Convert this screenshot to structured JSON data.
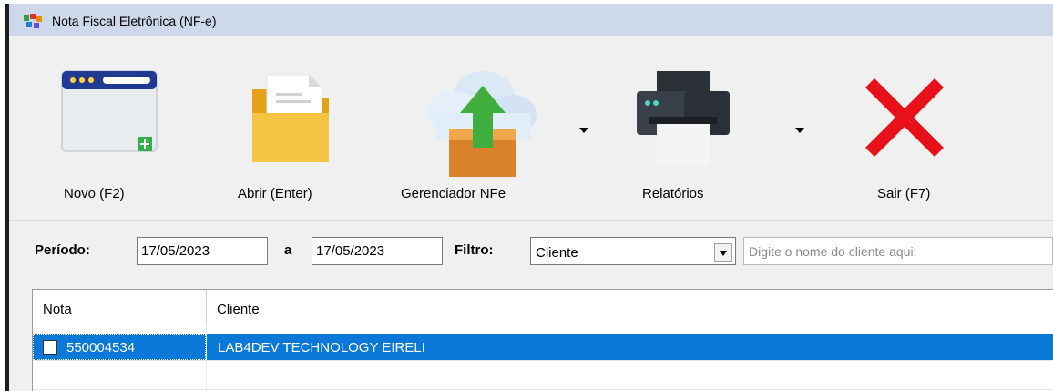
{
  "window": {
    "title": "Nota Fiscal Eletrônica (NF-e)"
  },
  "toolbar": {
    "buttons": [
      {
        "label": "Novo (F2)",
        "icon": "new-window-icon"
      },
      {
        "label": "Abrir (Enter)",
        "icon": "folder-open-icon"
      },
      {
        "label": "Gerenciador NFe",
        "icon": "cloud-upload-icon",
        "has_dropdown": true
      },
      {
        "label": "Relatórios",
        "icon": "printer-icon",
        "has_dropdown": true
      },
      {
        "label": "Sair (F7)",
        "icon": "close-x-icon"
      }
    ]
  },
  "filter": {
    "period_label": "Período:",
    "date_from": "17/05/2023",
    "to_label": "a",
    "date_to": "17/05/2023",
    "filter_label": "Filtro:",
    "filter_value": "Cliente",
    "search_placeholder": "Digite o nome do cliente aqui!"
  },
  "grid": {
    "columns": [
      "Nota",
      "Cliente"
    ],
    "rows": [
      {
        "nota": "550004534",
        "cliente": "LAB4DEV TECHNOLOGY EIRELI",
        "checked": false,
        "selected": true
      }
    ]
  },
  "colors": {
    "titlebar": "#cdd9eb",
    "selection": "#0a78d7",
    "exit_red": "#e8111a",
    "upload_green": "#3fae3f",
    "folder_yellow": "#f5c443"
  }
}
